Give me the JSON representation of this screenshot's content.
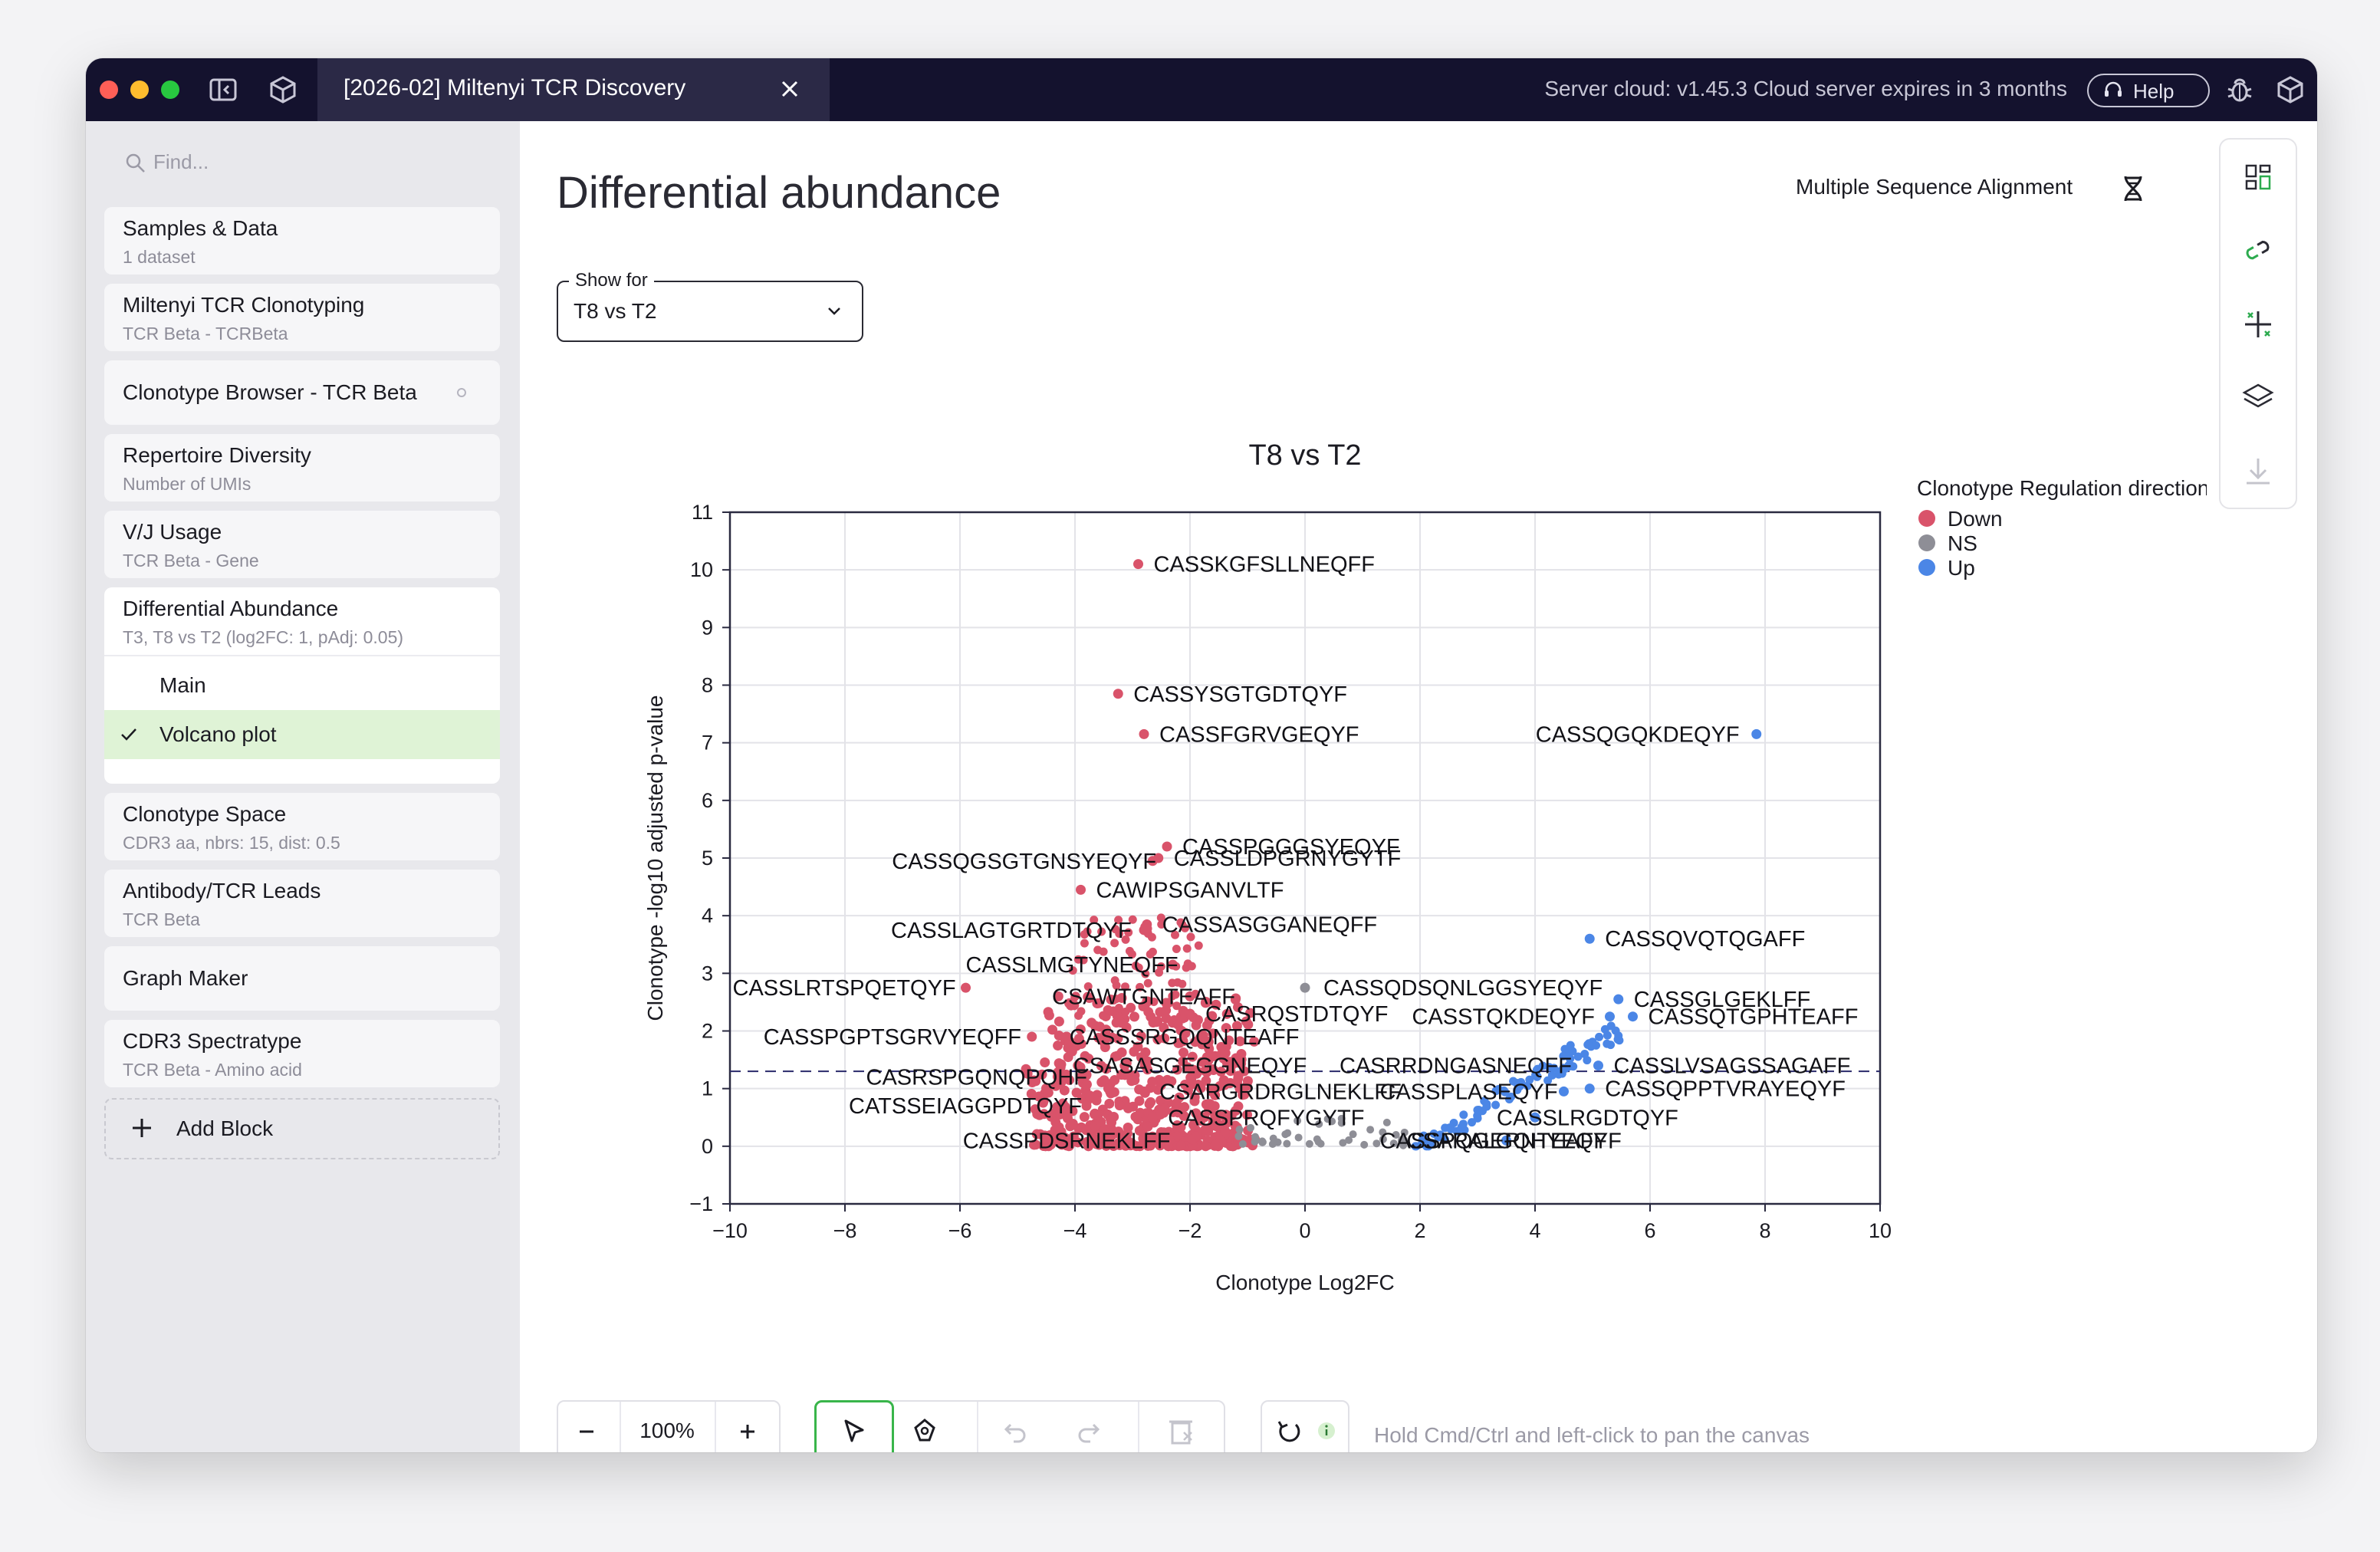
{
  "window": {
    "tab_title": "[2026-02] Miltenyi TCR Discovery",
    "server_status": "Server cloud: v1.45.3 Cloud server expires in 3 months",
    "help_label": "Help"
  },
  "sidebar": {
    "find_placeholder": "Find...",
    "blocks": [
      {
        "title": "Samples & Data",
        "subtitle": "1 dataset"
      },
      {
        "title": "Miltenyi TCR Clonotyping",
        "subtitle": "TCR Beta - TCRBeta"
      },
      {
        "title": "Clonotype Browser - TCR Beta",
        "subtitle": ""
      },
      {
        "title": "Repertoire Diversity",
        "subtitle": "Number of UMIs"
      },
      {
        "title": "V/J Usage",
        "subtitle": "TCR Beta - Gene"
      },
      {
        "title": "Differential Abundance",
        "subtitle": "T3, T8 vs T2 (log2FC: 1, pAdj: 0.05)"
      },
      {
        "title": "Clonotype Space",
        "subtitle": "CDR3 aa, nbrs: 15, dist: 0.5"
      },
      {
        "title": "Antibody/TCR Leads",
        "subtitle": "TCR Beta"
      },
      {
        "title": "Graph Maker",
        "subtitle": ""
      },
      {
        "title": "CDR3 Spectratype",
        "subtitle": "TCR Beta - Amino acid"
      }
    ],
    "sub_items": [
      "Main",
      "Volcano plot"
    ],
    "selected_sub_item": "Volcano plot",
    "add_block_label": "Add Block"
  },
  "main": {
    "page_title": "Differential abundance",
    "msa_label": "Multiple Sequence Alignment",
    "show_for_label": "Show for",
    "show_for_value": "T8 vs T2"
  },
  "chart_data": {
    "type": "scatter",
    "title": "T8 vs T2",
    "xlabel": "Clonotype Log2FC",
    "ylabel": "Clonotype -log10 adjusted p-value",
    "xlim": [
      -10,
      10
    ],
    "ylim": [
      -1,
      11
    ],
    "x_ticks": [
      "−10",
      "−8",
      "−6",
      "−4",
      "−2",
      "0",
      "2",
      "4",
      "6",
      "8",
      "10"
    ],
    "y_ticks": [
      "−1",
      "0",
      "1",
      "2",
      "3",
      "4",
      "5",
      "6",
      "7",
      "8",
      "9",
      "10",
      "11"
    ],
    "threshold_y": 1.3,
    "grid": true,
    "legend_title": "Clonotype Regulation direction",
    "legend_position": "right",
    "series": [
      {
        "name": "Down",
        "color": "#d9536a"
      },
      {
        "name": "NS",
        "color": "#8e8e96"
      },
      {
        "name": "Up",
        "color": "#4b86e6"
      }
    ],
    "labeled_points": [
      {
        "label": "CASSKGFSLLNEQFF",
        "x": -2.9,
        "y": 10.1,
        "dir": "Down"
      },
      {
        "label": "CASSYSGTGDTQYF",
        "x": -3.25,
        "y": 7.85,
        "dir": "Down"
      },
      {
        "label": "CASSFGRVGEQYF",
        "x": -2.8,
        "y": 7.15,
        "dir": "Down"
      },
      {
        "label": "CASSQGQKDEQYF",
        "x": 7.85,
        "y": 7.15,
        "dir": "Up"
      },
      {
        "label": "CASSPGGGSYEQYF",
        "x": -2.4,
        "y": 5.2,
        "dir": "Down"
      },
      {
        "label": "CASSQGSGTGNSYEQYF",
        "x": -2.65,
        "y": 4.95,
        "dir": "Down"
      },
      {
        "label": "CASSLDPGRNYGYTF",
        "x": -2.55,
        "y": 5.0,
        "dir": "Down"
      },
      {
        "label": "CAWIPSGANVLTF",
        "x": -3.9,
        "y": 4.45,
        "dir": "Down"
      },
      {
        "label": "CASSLAGTGRTDTQYF",
        "x": -2.8,
        "y": 3.75,
        "dir": "Down"
      },
      {
        "label": "CASSASGGANEQFF",
        "x": -2.75,
        "y": 3.85,
        "dir": "Down"
      },
      {
        "label": "CASSQVQTQGAFF",
        "x": 4.95,
        "y": 3.6,
        "dir": "Up"
      },
      {
        "label": "CASSLMGTYNEQFF",
        "x": -2.3,
        "y": 3.15,
        "dir": "Down"
      },
      {
        "label": "CASSQDSQNLGGSYEQYF",
        "x": 0.0,
        "y": 2.75,
        "dir": "NS"
      },
      {
        "label": "CSAWTGNTEAFF",
        "x": -2.0,
        "y": 2.6,
        "dir": "Down"
      },
      {
        "label": "CASSGLGEKLFF",
        "x": 5.45,
        "y": 2.55,
        "dir": "Up"
      },
      {
        "label": "CASSLRTSPQETQYF",
        "x": -5.9,
        "y": 2.75,
        "dir": "Down"
      },
      {
        "label": "CASRQSTDTQYF",
        "x": -2.0,
        "y": 2.3,
        "dir": "Down"
      },
      {
        "label": "CASSTQKDEQYF",
        "x": 5.3,
        "y": 2.25,
        "dir": "Up"
      },
      {
        "label": "CASSQTGPHTEAFF",
        "x": 5.7,
        "y": 2.25,
        "dir": "Up"
      },
      {
        "label": "CASSPGPTSGRVYEQFF",
        "x": -4.75,
        "y": 1.9,
        "dir": "Down"
      },
      {
        "label": "CASSSRGQQNTEAFF",
        "x": -4.15,
        "y": 1.9,
        "dir": "Down"
      },
      {
        "label": "CSASASGEGGNEQYF",
        "x": -3.95,
        "y": 1.4,
        "dir": "Down"
      },
      {
        "label": "CASRRDNGASNEQFF",
        "x": 4.6,
        "y": 1.4,
        "dir": "Up"
      },
      {
        "label": "CASSLVSAGSSAGAFF",
        "x": 5.1,
        "y": 1.4,
        "dir": "Up"
      },
      {
        "label": "CASRSPGQNQPQHF",
        "x": -3.9,
        "y": 1.2,
        "dir": "Down"
      },
      {
        "label": "CSARGRDRGLNEKLFF",
        "x": -2.8,
        "y": 0.95,
        "dir": "Down"
      },
      {
        "label": "CASSPLASEQYF",
        "x": 4.5,
        "y": 0.95,
        "dir": "Up"
      },
      {
        "label": "CASSQPPTVRAYEQYF",
        "x": 4.95,
        "y": 1.0,
        "dir": "Up"
      },
      {
        "label": "CATSSEIAGGPDTQYF",
        "x": -3.8,
        "y": 0.7,
        "dir": "Down"
      },
      {
        "label": "CASSPRQFYGYTF",
        "x": -2.65,
        "y": 0.5,
        "dir": "Down"
      },
      {
        "label": "CASSLRGDTQYF",
        "x": 4.0,
        "y": 0.5,
        "dir": "Up"
      },
      {
        "label": "CASSPDSRNEKLFF",
        "x": -2.35,
        "y": 0.1,
        "dir": "Down"
      },
      {
        "label": "CASSPQGERNTEAFF",
        "x": 1.7,
        "y": 0.1,
        "dir": "NS"
      },
      {
        "label": "CSARALGQHYEQYF",
        "x": 3.5,
        "y": 0.1,
        "dir": "Up"
      }
    ]
  },
  "canvas": {
    "zoom": "100%",
    "hint": "Hold Cmd/Ctrl and left-click to pan the canvas"
  }
}
